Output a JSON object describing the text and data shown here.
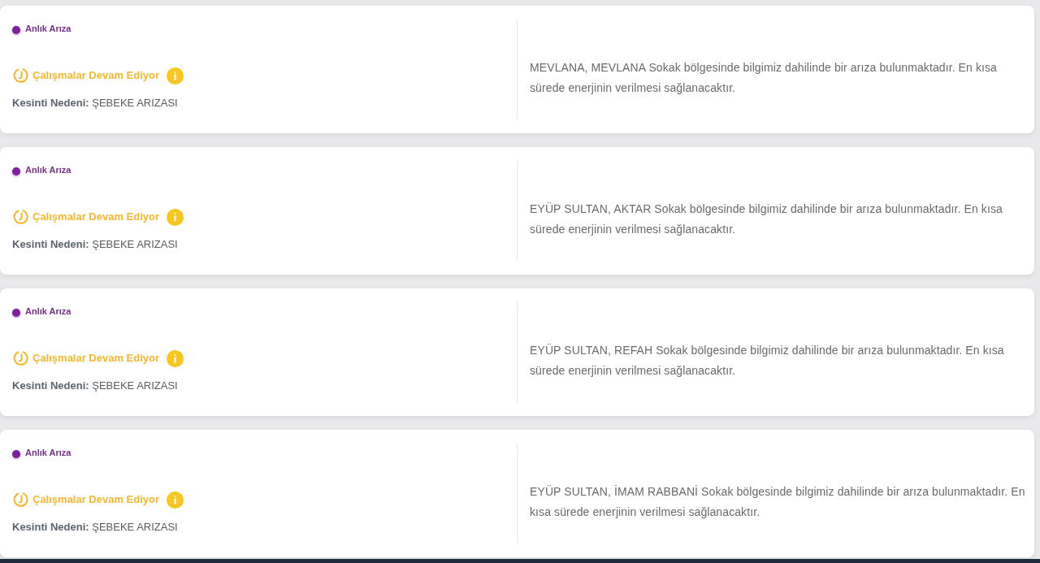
{
  "outages": [
    {
      "type_label": "Anlık Arıza",
      "status": "Çalışmalar Devam Ediyor",
      "reason": "**Kesinti Nedeni:** ŞEBEKE ARIZASI",
      "description": "MEVLANA, MEVLANA Sokak bölgesinde bilgimiz dahilinde bir arıza bulunmaktadır. En kısa sürede enerjinin verilmesi sağlanacaktır."
    },
    {
      "type_label": "Anlık Arıza",
      "status": "Çalışmalar Devam Ediyor",
      "reason": "**Kesinti Nedeni:** ŞEBEKE ARIZASI",
      "description": "EYÜP SULTAN, AKTAR Sokak bölgesinde bilgimiz dahilinde bir arıza bulunmaktadır. En kısa sürede enerjinin verilmesi sağlanacaktır."
    },
    {
      "type_label": "Anlık Arıza",
      "status": "Çalışmalar Devam Ediyor",
      "reason": "**Kesinti Nedeni:** ŞEBEKE ARIZASI",
      "description": "EYÜP SULTAN, REFAH Sokak bölgesinde bilgimiz dahilinde bir arıza bulunmaktadır. En kısa sürede enerjinin verilmesi sağlanacaktır."
    },
    {
      "type_label": "Anlık Arıza",
      "status": "Çalışmalar Devam Ediyor",
      "reason": "**Kesinti Nedeni:** ŞEBEKE ARIZASI",
      "description": "EYÜP SULTAN, İMAM RABBANİ Sokak bölgesinde bilgimiz dahilinde bir arıza bulunmaktadır. En kısa sürede enerjinin verilmesi sağlanacaktır."
    }
  ]
}
